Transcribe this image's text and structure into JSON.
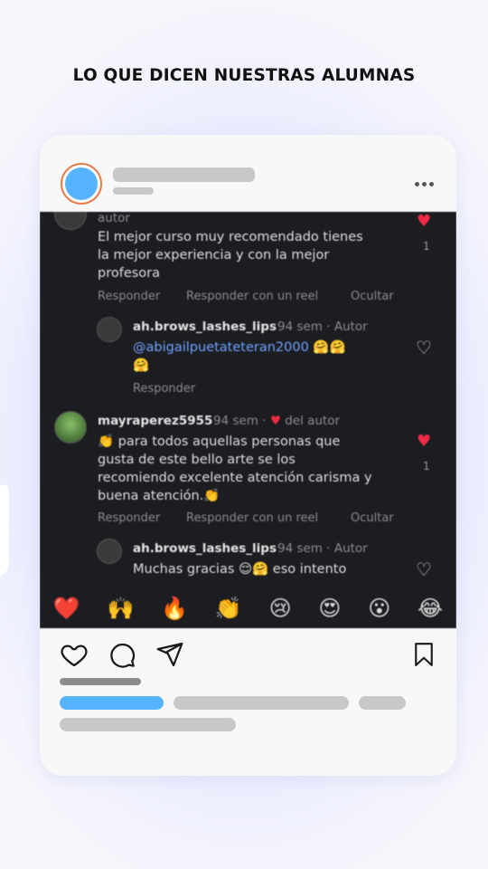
{
  "headline": "LO QUE DICEN NUESTRAS ALUMNAS",
  "comments": {
    "first": {
      "meta": "autor",
      "lines": [
        "El mejor curso muy recomendado tienes",
        "la mejor experiencia y con la mejor",
        "profesora"
      ],
      "likes": "1",
      "actions": [
        "Responder",
        "Responder con un reel",
        "Ocultar"
      ]
    },
    "reply1": {
      "user": "ah.brows_lashes_lips",
      "meta": "94 sem · Autor",
      "mention": "@abigailpuetateteran2000",
      "emoji_inline": "🤗🤗",
      "emoji_line2": "🤗",
      "action": "Responder"
    },
    "second": {
      "user": "mayraperez5955",
      "meta": "94 sem ·",
      "meta_suffix": "del autor",
      "lines": [
        "👏 para todos aquellas personas que",
        "gusta de este bello arte se los",
        "recomiendo excelente atención carisma y",
        "buena atención.👏"
      ],
      "likes": "1",
      "actions": [
        "Responder",
        "Responder con un reel",
        "Ocultar"
      ]
    },
    "reply2": {
      "user": "ah.brows_lashes_lips",
      "meta": "94 sem · Autor",
      "text": "Muchas gracias 😌🤗 eso intento"
    }
  },
  "emoji_bar": [
    "❤️",
    "🙌",
    "🔥",
    "👏",
    "😢",
    "😍",
    "😮",
    "😂"
  ],
  "icons": [
    "heart-icon",
    "comment-icon",
    "share-icon",
    "bookmark-icon",
    "more-icon"
  ],
  "colors": {
    "avatar": "#55b3ff",
    "avatar_ring": "#e87a4a",
    "accent_bar": "#55b3ff",
    "placeholder": "#c8c8c8",
    "like_red": "#ef2a44"
  }
}
